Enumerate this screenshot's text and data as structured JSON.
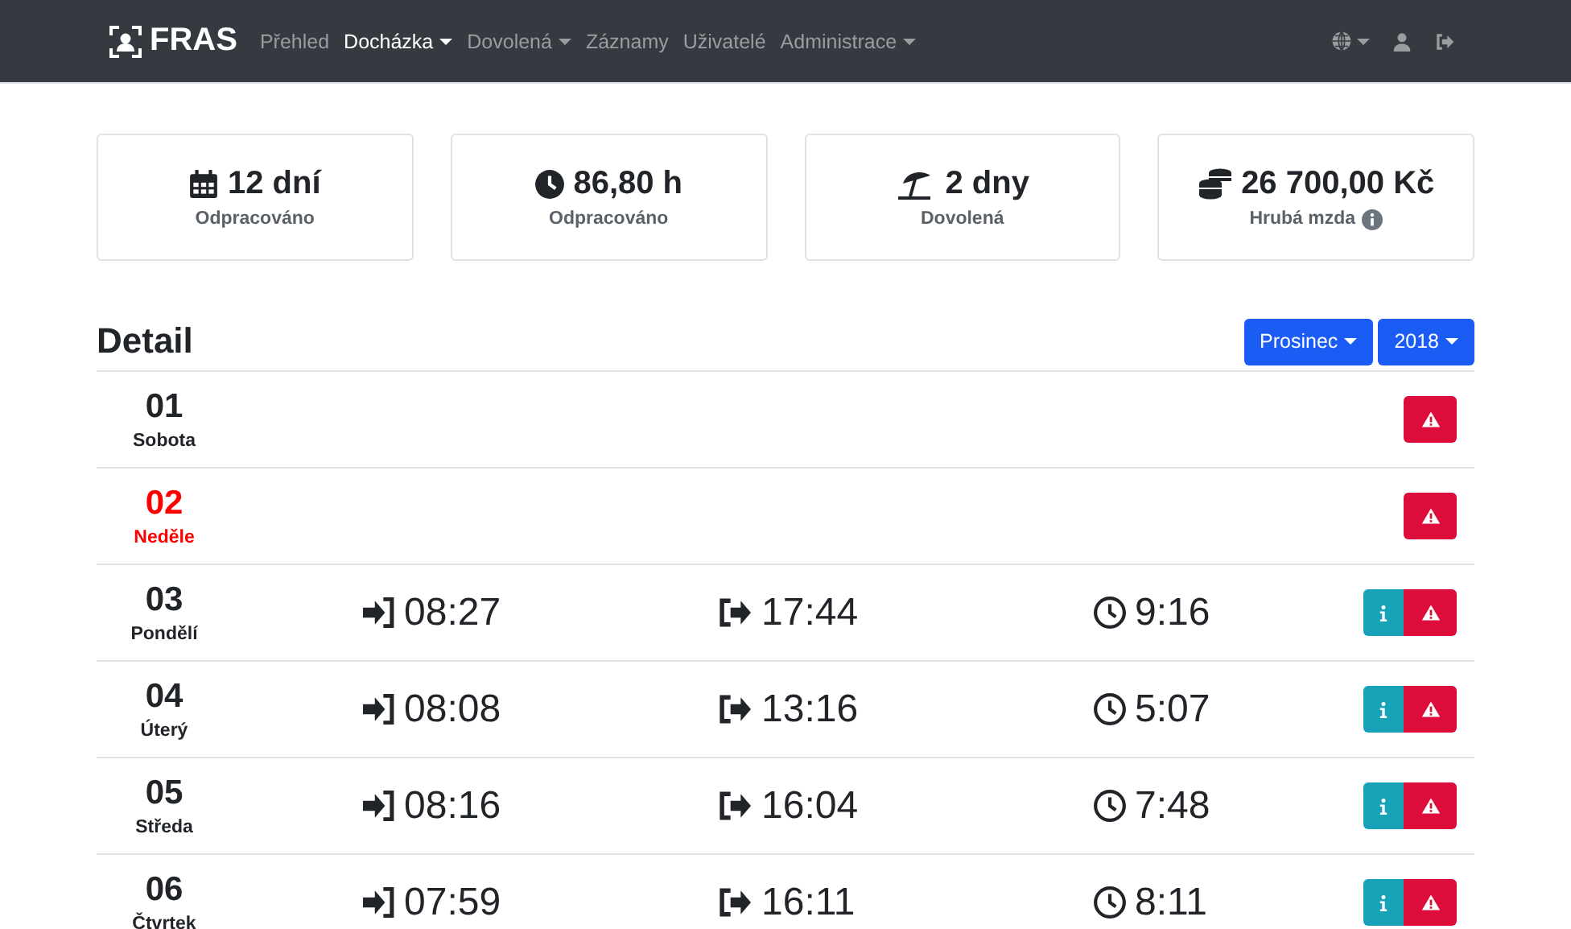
{
  "navbar": {
    "brand": "FRAS",
    "items": [
      {
        "label": "Přehled",
        "selected": false,
        "dropdown": false
      },
      {
        "label": "Docházka",
        "selected": true,
        "dropdown": true
      },
      {
        "label": "Dovolená",
        "selected": false,
        "dropdown": true
      },
      {
        "label": "Záznamy",
        "selected": false,
        "dropdown": false
      },
      {
        "label": "Uživatelé",
        "selected": false,
        "dropdown": false
      },
      {
        "label": "Administrace",
        "selected": false,
        "dropdown": true
      }
    ]
  },
  "stats": [
    {
      "kind": "calendar",
      "value": "12 dní",
      "label": "Odpracováno",
      "info": false
    },
    {
      "kind": "clock",
      "value": "86,80 h",
      "label": "Odpracováno",
      "info": false
    },
    {
      "kind": "beach",
      "value": "2 dny",
      "label": "Dovolená",
      "info": false
    },
    {
      "kind": "coins",
      "value": "26 700,00 Kč",
      "label": "Hrubá mzda",
      "info": true
    }
  ],
  "detail": {
    "title": "Detail",
    "month": "Prosinec",
    "year": "2018"
  },
  "days": [
    {
      "day": "01",
      "weekday": "Sobota",
      "holiday": false
    },
    {
      "day": "02",
      "weekday": "Neděle",
      "holiday": true
    },
    {
      "day": "03",
      "weekday": "Pondělí",
      "holiday": false,
      "arrival": "08:27",
      "departure": "17:44",
      "duration": "9:16"
    },
    {
      "day": "04",
      "weekday": "Úterý",
      "holiday": false,
      "arrival": "08:08",
      "departure": "13:16",
      "duration": "5:07"
    },
    {
      "day": "05",
      "weekday": "Středa",
      "holiday": false,
      "arrival": "08:16",
      "departure": "16:04",
      "duration": "7:48"
    },
    {
      "day": "06",
      "weekday": "Čtvrtek",
      "holiday": false,
      "arrival": "07:59",
      "departure": "16:11",
      "duration": "8:11"
    }
  ]
}
